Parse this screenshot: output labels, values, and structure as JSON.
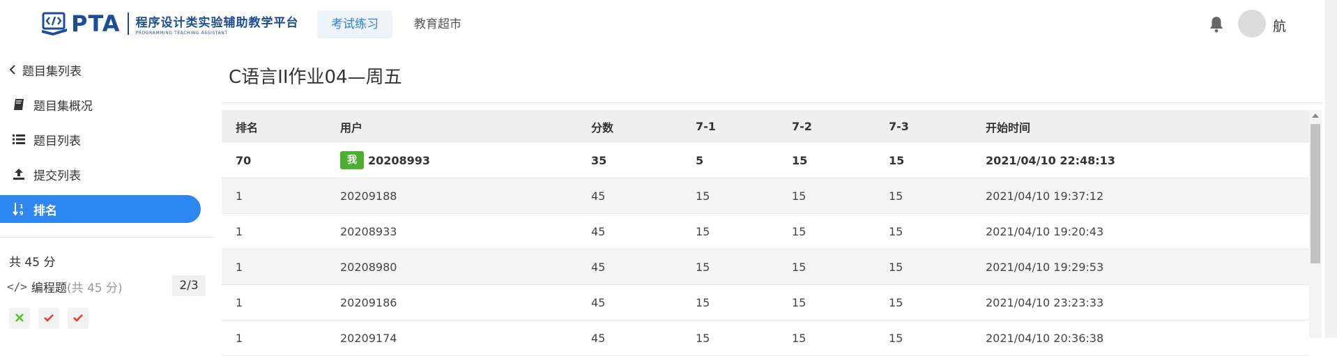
{
  "header": {
    "logo_text": "PTA",
    "logo_cn": "程序设计类实验辅助教学平台",
    "logo_en": "PROGRAMMING TEACHING ASSISTANT",
    "tabs": [
      {
        "label": "考试练习",
        "active": true
      },
      {
        "label": "教育超市",
        "active": false
      }
    ],
    "icons": {
      "notification": "bell-icon",
      "avatar": "user-avatar"
    },
    "user_name": "航"
  },
  "sidebar": {
    "back_label": "题目集列表",
    "items": [
      {
        "label": "题目集概况",
        "icon": "book-icon"
      },
      {
        "label": "题目列表",
        "icon": "list-icon"
      },
      {
        "label": "提交列表",
        "icon": "upload-icon"
      },
      {
        "label": "排名",
        "icon": "sort-numeric-icon",
        "active": true
      }
    ],
    "total": "共 45 分",
    "programming": {
      "icon": "code-icon",
      "label": "编程题",
      "sub": "(共 45 分)",
      "count": "2/3"
    },
    "statuses": [
      {
        "result": "wrong",
        "icon": "cross-icon",
        "color": "#52c41a"
      },
      {
        "result": "correct",
        "icon": "check-icon",
        "color": "#e53935"
      },
      {
        "result": "correct",
        "icon": "check-icon",
        "color": "#e53935"
      }
    ]
  },
  "main": {
    "title": "C语言II作业04—周五",
    "table": {
      "columns": [
        "排名",
        "用户",
        "分数",
        "7-1",
        "7-2",
        "7-3",
        "开始时间"
      ],
      "me_badge": "我",
      "rows": [
        {
          "rank": "70",
          "user": "20208993",
          "score": "35",
          "p1": "5",
          "p2": "15",
          "p3": "15",
          "start": "2021/04/10 22:48:13",
          "is_me": true
        },
        {
          "rank": "1",
          "user": "20209188",
          "score": "45",
          "p1": "15",
          "p2": "15",
          "p3": "15",
          "start": "2021/04/10 19:37:12"
        },
        {
          "rank": "1",
          "user": "20208933",
          "score": "45",
          "p1": "15",
          "p2": "15",
          "p3": "15",
          "start": "2021/04/10 19:20:43"
        },
        {
          "rank": "1",
          "user": "20208980",
          "score": "45",
          "p1": "15",
          "p2": "15",
          "p3": "15",
          "start": "2021/04/10 19:29:53"
        },
        {
          "rank": "1",
          "user": "20209186",
          "score": "45",
          "p1": "15",
          "p2": "15",
          "p3": "15",
          "start": "2021/04/10 23:23:33"
        },
        {
          "rank": "1",
          "user": "20209174",
          "score": "45",
          "p1": "15",
          "p2": "15",
          "p3": "15",
          "start": "2021/04/10 20:36:38"
        }
      ]
    }
  },
  "colors": {
    "brand": "#1d4d97",
    "accent": "#2e86f0",
    "me_badge": "#4caf2f"
  }
}
